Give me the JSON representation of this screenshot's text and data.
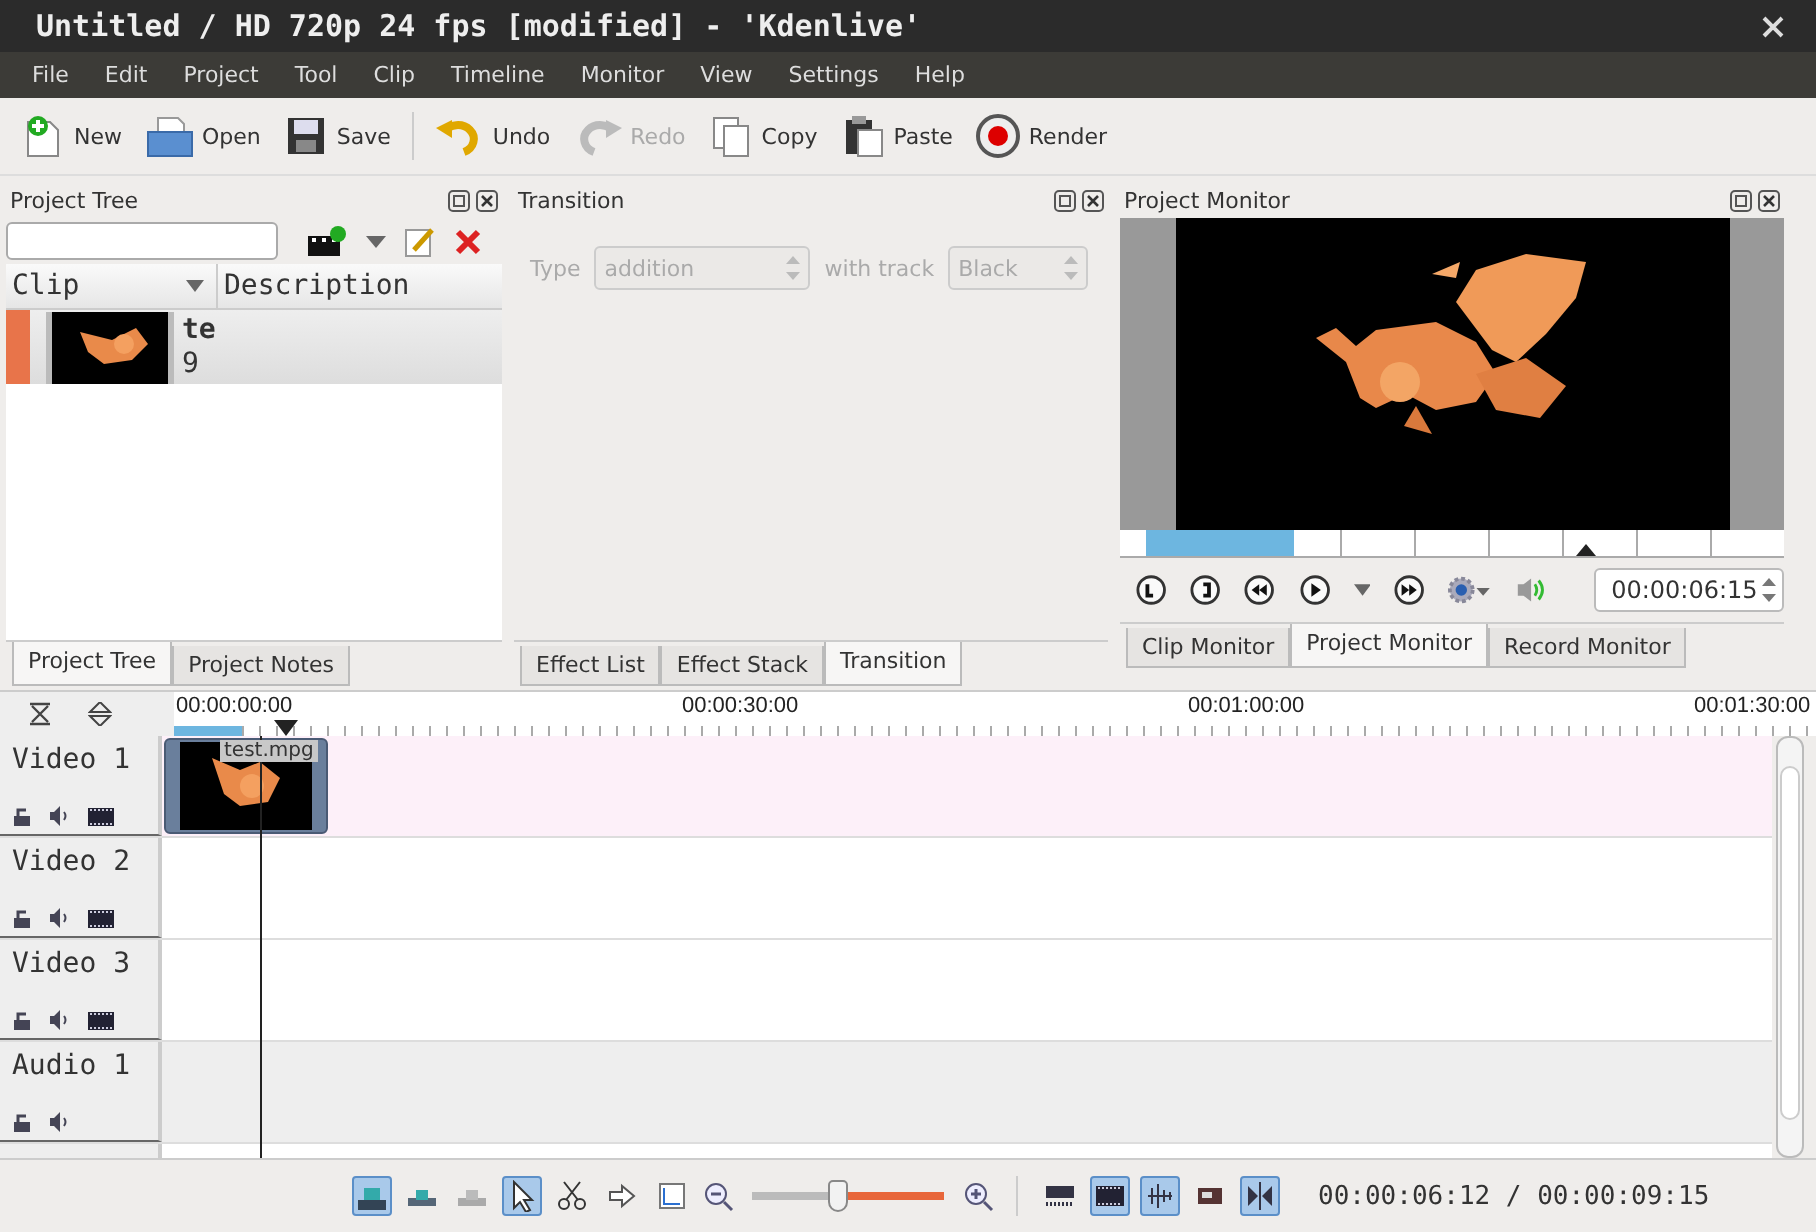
{
  "window": {
    "title": "Untitled / HD 720p 24 fps [modified] - 'Kdenlive'"
  },
  "menu": [
    "File",
    "Edit",
    "Project",
    "Tool",
    "Clip",
    "Timeline",
    "Monitor",
    "View",
    "Settings",
    "Help"
  ],
  "toolbar": [
    {
      "kind": "new",
      "label": "New",
      "disabled": false
    },
    {
      "kind": "open",
      "label": "Open",
      "disabled": false
    },
    {
      "kind": "save",
      "label": "Save",
      "disabled": false
    },
    {
      "kind": "undo",
      "label": "Undo",
      "disabled": false
    },
    {
      "kind": "redo",
      "label": "Redo",
      "disabled": true
    },
    {
      "kind": "copy",
      "label": "Copy",
      "disabled": false
    },
    {
      "kind": "paste",
      "label": "Paste",
      "disabled": false
    },
    {
      "kind": "render",
      "label": "Render",
      "disabled": false
    }
  ],
  "project_tree": {
    "title": "Project Tree",
    "columns": [
      "Clip",
      "Description"
    ],
    "clips": [
      {
        "name": "te",
        "duration": "9",
        "selected": true
      }
    ],
    "tabs": [
      {
        "label": "Project Tree",
        "selected": true
      },
      {
        "label": "Project Notes",
        "selected": false
      }
    ]
  },
  "transition": {
    "title": "Transition",
    "type_label": "Type",
    "type_value": "addition",
    "track_label": "with track",
    "track_value": "Black",
    "disabled": true,
    "tabs": [
      {
        "label": "Effect List",
        "selected": false
      },
      {
        "label": "Effect Stack",
        "selected": false
      },
      {
        "label": "Transition",
        "selected": true
      }
    ]
  },
  "monitor": {
    "title": "Project Monitor",
    "timecode": "00:00:06:15",
    "tabs": [
      {
        "label": "Clip Monitor",
        "selected": false
      },
      {
        "label": "Project Monitor",
        "selected": true
      },
      {
        "label": "Record Monitor",
        "selected": false
      }
    ]
  },
  "timeline": {
    "ruler": [
      "00:00:00:00",
      "00:00:30:00",
      "00:01:00:00",
      "00:01:30:00"
    ],
    "tracks": [
      {
        "name": "Video 1",
        "kind": "video",
        "clips": [
          {
            "label": "test.mpg"
          }
        ]
      },
      {
        "name": "Video 2",
        "kind": "video"
      },
      {
        "name": "Video 3",
        "kind": "video"
      },
      {
        "name": "Audio 1",
        "kind": "audio"
      }
    ],
    "tools": [
      {
        "kind": "normal",
        "checked": true
      },
      {
        "kind": "overwrite",
        "checked": false
      },
      {
        "kind": "insert",
        "checked": false
      },
      {
        "kind": "select",
        "checked": true
      },
      {
        "kind": "razor",
        "checked": false
      },
      {
        "kind": "spacer",
        "checked": false
      },
      {
        "kind": "fit",
        "checked": false
      }
    ],
    "zoom": {
      "level": 0.45
    },
    "toggles": [
      {
        "kind": "video-thumbs",
        "checked": false
      },
      {
        "kind": "frames",
        "checked": true
      },
      {
        "kind": "audio-thumbs",
        "checked": true
      },
      {
        "kind": "markers",
        "checked": false
      },
      {
        "kind": "snap",
        "checked": true
      }
    ],
    "timecode": "00:00:06:12 / 00:00:09:15"
  }
}
